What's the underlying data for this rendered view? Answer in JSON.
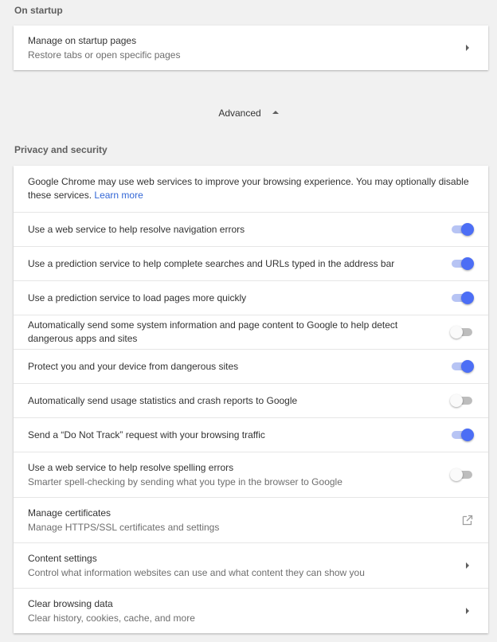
{
  "on_startup": {
    "title": "On startup",
    "item": {
      "label": "Manage on startup pages",
      "sublabel": "Restore tabs or open specific pages"
    }
  },
  "advanced": {
    "label": "Advanced"
  },
  "privacy": {
    "title": "Privacy and security",
    "intro": {
      "text": "Google Chrome may use web services to improve your browsing experience. You may optionally disable these services.",
      "link": "Learn more"
    },
    "toggles": [
      {
        "label": "Use a web service to help resolve navigation errors",
        "on": true
      },
      {
        "label": "Use a prediction service to help complete searches and URLs typed in the address bar",
        "on": true
      },
      {
        "label": "Use a prediction service to load pages more quickly",
        "on": true
      },
      {
        "label": "Automatically send some system information and page content to Google to help detect dangerous apps and sites",
        "on": false
      },
      {
        "label": "Protect you and your device from dangerous sites",
        "on": true
      },
      {
        "label": "Automatically send usage statistics and crash reports to Google",
        "on": false
      },
      {
        "label": "Send a “Do Not Track” request with your browsing traffic",
        "on": true
      },
      {
        "label": "Use a web service to help resolve spelling errors",
        "sublabel": "Smarter spell-checking by sending what you type in the browser to Google",
        "on": false
      }
    ],
    "links": [
      {
        "label": "Manage certificates",
        "sublabel": "Manage HTTPS/SSL certificates and settings",
        "icon": "external-link-icon"
      },
      {
        "label": "Content settings",
        "sublabel": "Control what information websites can use and what content they can show you",
        "icon": "chevron-right-icon"
      },
      {
        "label": "Clear browsing data",
        "sublabel": "Clear history, cookies, cache, and more",
        "icon": "chevron-right-icon"
      }
    ]
  },
  "colors": {
    "accent": "#4c6ef5",
    "link": "#3367d6",
    "background": "#f1f1f1"
  }
}
